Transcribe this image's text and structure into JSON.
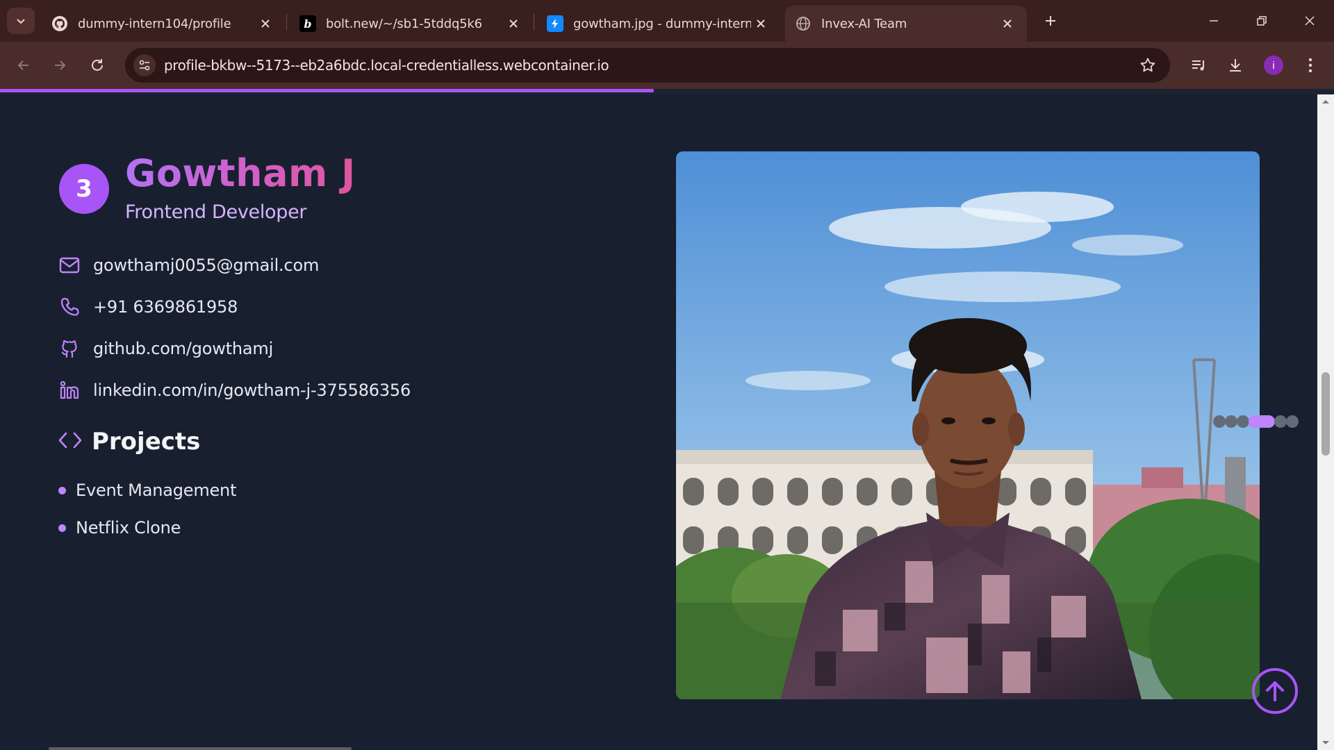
{
  "browser": {
    "tabs": [
      {
        "title": "dummy-intern104/profile",
        "icon": "github-icon"
      },
      {
        "title": "bolt.new/~/sb1-5tddq5k6",
        "icon": "bolt-icon"
      },
      {
        "title": "gowtham.jpg - dummy-intern1",
        "icon": "stackblitz-icon"
      },
      {
        "title": "Invex-AI Team",
        "icon": "globe-icon",
        "active": true
      }
    ],
    "url": "profile-bkbw--5173--eb2a6bdc.local-credentialless.webcontainer.io",
    "profile_initial": "i",
    "page_load_progress": 0.49
  },
  "profile": {
    "number": "3",
    "name": "Gowtham J",
    "role": "Frontend Developer",
    "contacts": {
      "email": "gowthamj0055@gmail.com",
      "phone": "+91 6369861958",
      "github": "github.com/gowthamj",
      "linkedin": "linkedin.com/in/gowtham-j-375586356"
    },
    "projects_heading": "Projects",
    "projects": [
      "Event Management",
      "Netflix Clone"
    ]
  },
  "carousel": {
    "total": 6,
    "active_index": 3
  },
  "colors": {
    "accent": "#a855f7",
    "accent_light": "#c084fc",
    "background": "#182030"
  }
}
